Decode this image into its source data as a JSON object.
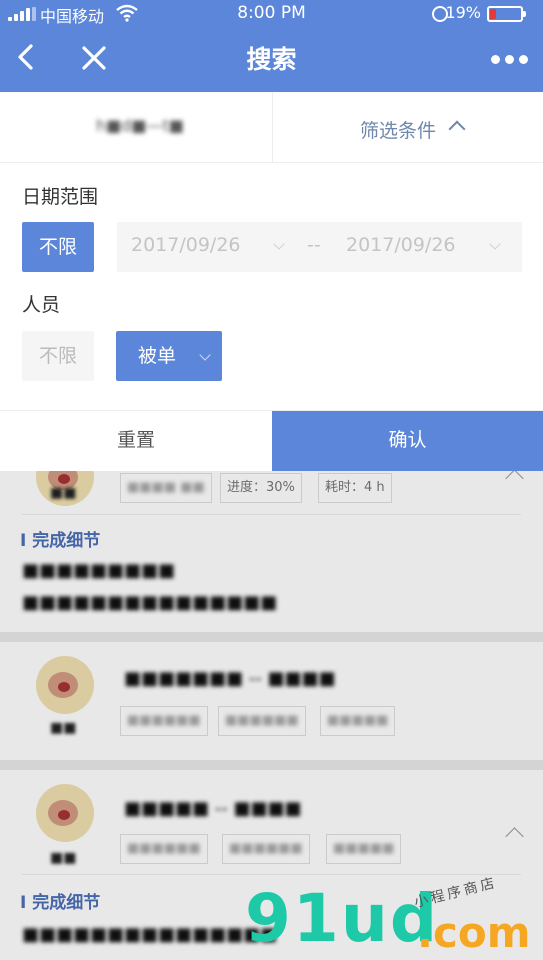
{
  "status_bar": {
    "carrier": "中国移动",
    "time": "8:00 PM",
    "battery": "19%",
    "battery_level": 0.19
  },
  "nav": {
    "title": "搜索"
  },
  "search": {
    "query": "h■d■—t■",
    "filter_tab": "筛选条件"
  },
  "filter": {
    "date_label": "日期范围",
    "date_any": "不限",
    "date_from": "2017/09/26",
    "date_sep": "--",
    "date_to": "2017/09/26",
    "person_label": "人员",
    "person_any": "不限",
    "person_selected": "被单",
    "reset": "重置",
    "confirm": "确认"
  },
  "cards": [
    {
      "tags": [
        "■■■■ ■■",
        "进度：30%",
        "耗时：4 h"
      ],
      "name": "■■",
      "detail_header": "完成细节",
      "detail_lines": [
        "■■■■■■■■■",
        "■■■■■■■■■■■■■■■"
      ]
    },
    {
      "name": "■■",
      "title": "■■■■■■■ -- ■■■■",
      "tags": [
        "■■■■■■",
        "■■■■■■",
        "■■■■■"
      ]
    },
    {
      "name": "■■",
      "title": "■■■■■ -- ■■■■",
      "tags": [
        "■■■■■■",
        "■■■■■■",
        "■■■■■"
      ],
      "detail_header": "完成细节",
      "detail_lines": [
        "■■■■■■■■■■■■■■■"
      ]
    }
  ],
  "watermark": {
    "brand": "91ud",
    "tld": ".com",
    "tagline": "小程序商店"
  },
  "colors": {
    "accent": "#5b86d9",
    "link": "#4b6fb8",
    "battery_low": "#e23b3b"
  }
}
